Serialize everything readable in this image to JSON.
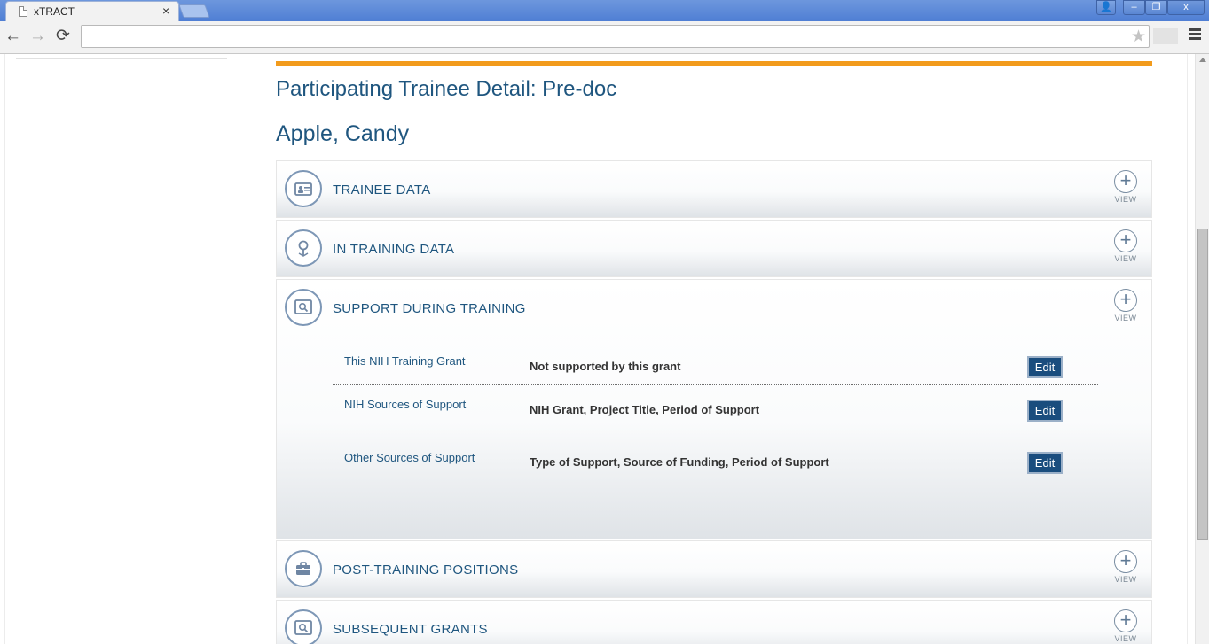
{
  "browser": {
    "tab_title": "xTRACT",
    "tab_close": "×",
    "win_user": "👤",
    "win_min": "–",
    "win_max": "❐",
    "win_close": "x",
    "back": "←",
    "forward": "→",
    "reload": "⟳",
    "address": "",
    "star": "★"
  },
  "page": {
    "title": "Participating Trainee Detail: Pre-doc",
    "trainee_name": "Apple, Candy",
    "accent_color": "#f29b1c",
    "title_color": "#1f567f"
  },
  "sections": [
    {
      "title": "TRAINEE DATA",
      "icon": "id-card-icon",
      "view_label": "VIEW",
      "expanded": false
    },
    {
      "title": "IN TRAINING DATA",
      "icon": "map-pin-icon",
      "view_label": "VIEW",
      "expanded": false
    },
    {
      "title": "SUPPORT DURING TRAINING",
      "icon": "magnifier-icon",
      "view_label": "VIEW",
      "expanded": true
    },
    {
      "title": "POST-TRAINING POSITIONS",
      "icon": "briefcase-icon",
      "view_label": "VIEW",
      "expanded": false
    },
    {
      "title": "SUBSEQUENT GRANTS",
      "icon": "magnifier-icon",
      "view_label": "VIEW",
      "expanded": false
    }
  ],
  "view_plus": "+",
  "support_rows": [
    {
      "label": "This NIH Training Grant",
      "value": "Not supported by this grant",
      "button": "Edit"
    },
    {
      "label": "NIH Sources of Support",
      "value": "NIH Grant, Project Title, Period of Support",
      "button": "Edit"
    },
    {
      "label": "Other Sources of Support",
      "value": "Type of Support, Source of Funding, Period of Support",
      "button": "Edit"
    }
  ]
}
